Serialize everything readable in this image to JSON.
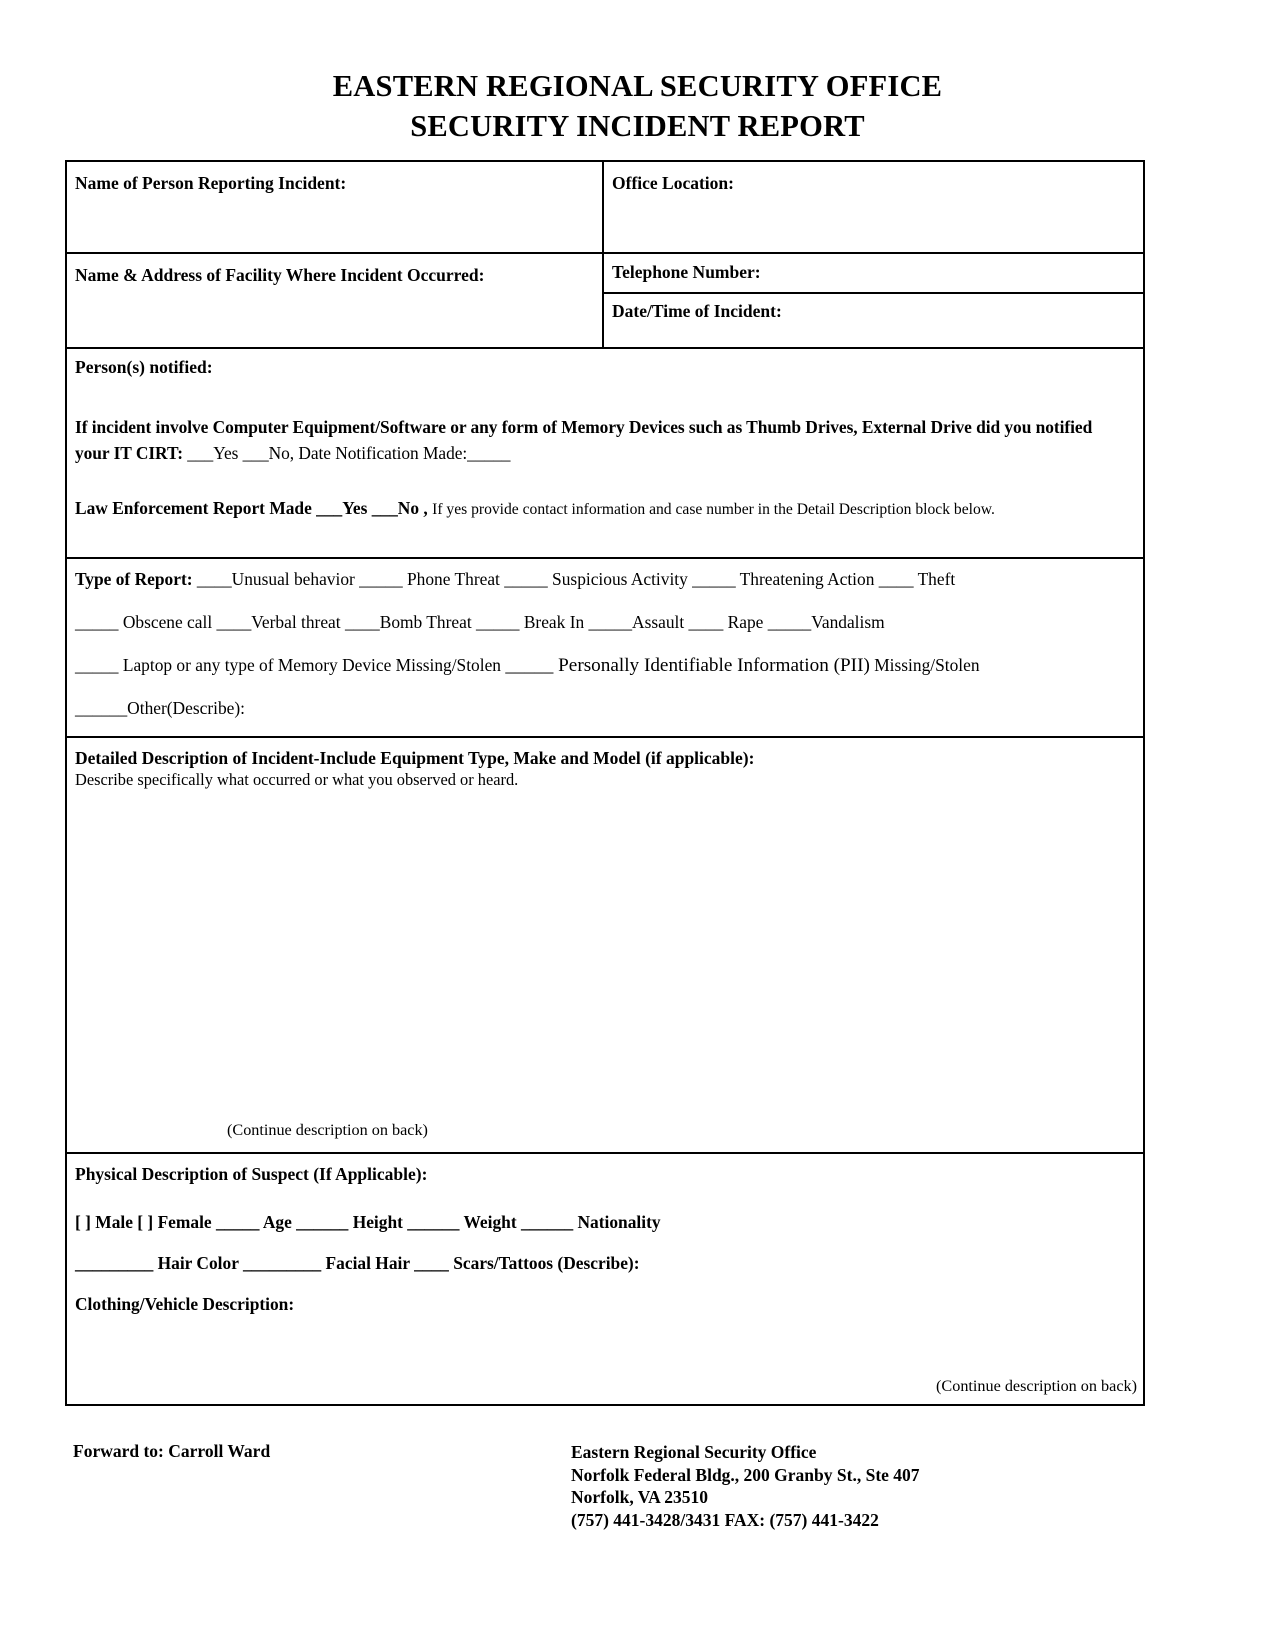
{
  "title": {
    "line1": "EASTERN REGIONAL SECURITY OFFICE",
    "line2": "SECURITY INCIDENT REPORT"
  },
  "section_identification": {
    "name_of_person_reporting": "Name of Person Reporting Incident:",
    "office_location": "Office Location:",
    "facility_name_address": "Name & Address of Facility Where Incident Occurred:",
    "telephone_number": "Telephone Number:",
    "date_time_of_incident": "Date/Time of Incident:"
  },
  "section_notification": {
    "persons_notified": "Person(s) notified:",
    "it_cirt_question": "If incident involve Computer Equipment/Software or any form of Memory Devices such as Thumb Drives, External Drive did you notified",
    "it_cirt_label": "your IT CIRT:",
    "it_cirt_options": "___Yes   ___No,   Date Notification Made:_____",
    "law_enforcement_label": "Law Enforcement Report Made ___Yes    ___No ,",
    "law_enforcement_note": "If yes provide contact information and case number in the Detail Description block below."
  },
  "section_type_of_report": {
    "label": "Type of Report:",
    "line1": "____Unusual behavior  _____  Phone Threat   _____  Suspicious Activity   _____  Threatening Action  ____  Theft",
    "line2": "_____  Obscene call     ____Verbal threat      ____Bomb Threat   _____  Break In  _____Assault  ____  Rape    _____Vandalism",
    "line3_a": "_____   Laptop or any type of Memory Device Missing/Stolen",
    "line3_b": "_____  Personally Identifiable Information (PII)",
    "line3_c": " Missing/Stolen",
    "line4": "______Other(Describe):"
  },
  "section_detailed_description": {
    "heading": "Detailed Description of Incident-Include Equipment Type, Make and Model (if applicable):",
    "subheading": "Describe specifically what occurred or what you observed or heard.",
    "continue_note": "(Continue description on back)"
  },
  "section_physical_description": {
    "heading": "Physical Description of Suspect (If Applicable):",
    "line1": "[ ] Male    [ ]  Female       _____   Age          ______  Height         ______  Weight        ______  Nationality",
    "line2": "_________   Hair Color          _________   Facial Hair     ____  Scars/Tattoos (Describe):",
    "clothing_vehicle": "Clothing/Vehicle Description:",
    "continue_note": "(Continue description on back)"
  },
  "footer": {
    "forward_to": "Forward to: Carroll Ward",
    "office_name": "Eastern Regional Security Office",
    "address_line1": "Norfolk Federal Bldg., 200 Granby St., Ste 407",
    "address_line2": "Norfolk, VA 23510",
    "contact_line": "(757) 441-3428/3431     FAX: (757) 441-3422"
  }
}
